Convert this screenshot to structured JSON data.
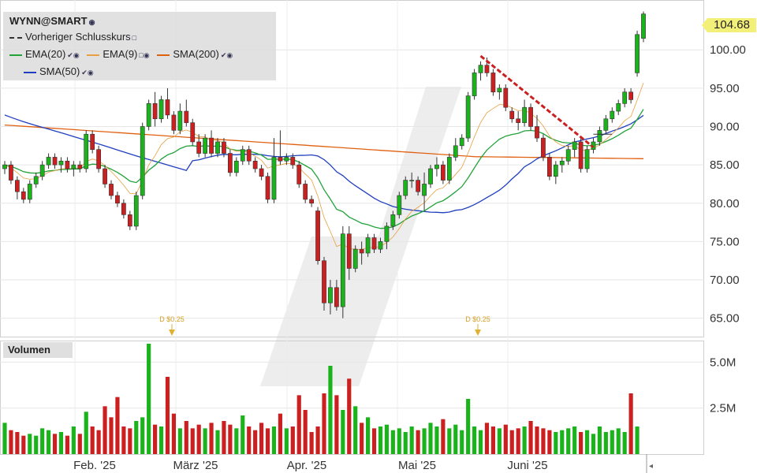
{
  "header": {
    "symbol": "WYNN@SMART",
    "legend": [
      {
        "label": "Vorheriger Schlusskurs",
        "color": "#333333",
        "style": "dashed"
      },
      {
        "label": "EMA(20)",
        "color": "#22a33a"
      },
      {
        "label": "EMA(9)",
        "color": "#e8a040"
      },
      {
        "label": "SMA(200)",
        "color": "#e06010"
      },
      {
        "label": "SMA(50)",
        "color": "#1f3fbf"
      }
    ]
  },
  "last_price": "104.68",
  "volume_label": "Volumen",
  "dividends": [
    "D $0.25",
    "D $0.25"
  ],
  "chart_data": {
    "type": "candlestick",
    "x_labels": [
      "Feb. '25",
      "März '25",
      "Apr. '25",
      "Mai '25",
      "Juni '25"
    ],
    "y_ticks": [
      "65.00",
      "70.00",
      "75.00",
      "80.00",
      "85.00",
      "90.00",
      "95.00",
      "100.00"
    ],
    "y_range": [
      62.5,
      106.5
    ],
    "volume_ticks": [
      "2.5M",
      "5.0M"
    ],
    "volume_range": [
      0,
      6.0
    ],
    "candles": [
      [
        84.5,
        85.5,
        83.8,
        85.0
      ],
      [
        85.0,
        85.5,
        82.5,
        83.0
      ],
      [
        83.0,
        83.5,
        80.5,
        81.5
      ],
      [
        81.5,
        82.0,
        80.0,
        80.5
      ],
      [
        80.5,
        83.0,
        80.0,
        82.5
      ],
      [
        82.5,
        84.0,
        82.0,
        83.5
      ],
      [
        83.5,
        85.5,
        83.0,
        85.0
      ],
      [
        85.0,
        86.5,
        84.5,
        86.0
      ],
      [
        86.0,
        86.5,
        84.5,
        85.0
      ],
      [
        85.0,
        86.0,
        84.0,
        85.5
      ],
      [
        85.5,
        86.0,
        84.0,
        84.5
      ],
      [
        84.5,
        85.5,
        83.5,
        85.0
      ],
      [
        85.0,
        85.5,
        84.0,
        84.5
      ],
      [
        84.5,
        89.5,
        84.0,
        89.0
      ],
      [
        89.0,
        89.5,
        86.5,
        87.0
      ],
      [
        87.0,
        87.5,
        84.0,
        84.5
      ],
      [
        84.5,
        85.0,
        82.0,
        82.5
      ],
      [
        82.5,
        83.0,
        80.5,
        81.0
      ],
      [
        81.0,
        81.5,
        79.5,
        80.0
      ],
      [
        80.0,
        80.5,
        78.0,
        78.5
      ],
      [
        78.5,
        79.0,
        76.5,
        77.0
      ],
      [
        77.0,
        81.5,
        76.5,
        81.0
      ],
      [
        81.0,
        90.5,
        80.5,
        90.0
      ],
      [
        90.0,
        93.5,
        89.5,
        93.0
      ],
      [
        93.0,
        94.5,
        90.0,
        91.0
      ],
      [
        91.0,
        94.0,
        90.5,
        93.5
      ],
      [
        93.5,
        95.0,
        91.0,
        91.5
      ],
      [
        91.5,
        92.0,
        89.0,
        89.5
      ],
      [
        89.5,
        93.0,
        89.0,
        92.0
      ],
      [
        92.0,
        93.5,
        90.0,
        90.5
      ],
      [
        90.5,
        91.0,
        87.5,
        88.0
      ],
      [
        88.0,
        89.0,
        86.0,
        86.5
      ],
      [
        86.5,
        89.0,
        86.0,
        88.5
      ],
      [
        88.5,
        89.5,
        86.0,
        86.5
      ],
      [
        86.5,
        88.5,
        86.0,
        88.0
      ],
      [
        88.0,
        88.5,
        86.0,
        86.5
      ],
      [
        86.5,
        87.0,
        83.5,
        84.0
      ],
      [
        84.0,
        86.0,
        83.5,
        85.5
      ],
      [
        85.5,
        87.5,
        85.0,
        87.0
      ],
      [
        87.0,
        87.5,
        85.0,
        85.5
      ],
      [
        85.5,
        86.0,
        84.0,
        84.5
      ],
      [
        84.5,
        85.0,
        83.0,
        83.5
      ],
      [
        83.5,
        84.0,
        80.0,
        80.5
      ],
      [
        80.5,
        88.5,
        80.0,
        86.0
      ],
      [
        86.0,
        89.5,
        85.0,
        85.5
      ],
      [
        85.5,
        86.5,
        85.0,
        86.0
      ],
      [
        86.0,
        86.5,
        84.5,
        85.0
      ],
      [
        85.0,
        85.5,
        82.0,
        82.5
      ],
      [
        82.5,
        83.0,
        80.0,
        80.5
      ],
      [
        80.5,
        81.0,
        79.5,
        80.0
      ],
      [
        79.0,
        79.5,
        72.0,
        72.5
      ],
      [
        72.5,
        73.0,
        66.0,
        67.0
      ],
      [
        67.0,
        70.0,
        65.5,
        69.0
      ],
      [
        69.0,
        70.0,
        66.0,
        66.5
      ],
      [
        66.5,
        77.0,
        65.0,
        76.0
      ],
      [
        76.0,
        77.0,
        70.0,
        71.5
      ],
      [
        71.5,
        74.5,
        71.0,
        74.0
      ],
      [
        74.0,
        75.0,
        72.0,
        73.5
      ],
      [
        73.5,
        76.0,
        73.0,
        75.5
      ],
      [
        75.5,
        76.0,
        73.5,
        74.0
      ],
      [
        74.0,
        75.5,
        73.5,
        75.0
      ],
      [
        75.0,
        77.5,
        74.0,
        77.0
      ],
      [
        77.0,
        79.0,
        76.5,
        78.5
      ],
      [
        78.5,
        81.5,
        78.0,
        81.0
      ],
      [
        81.0,
        83.5,
        80.5,
        83.0
      ],
      [
        83.0,
        84.0,
        82.0,
        83.0
      ],
      [
        83.0,
        83.5,
        81.0,
        81.5
      ],
      [
        81.0,
        84.0,
        79.0,
        82.5
      ],
      [
        82.5,
        85.0,
        82.0,
        84.5
      ],
      [
        84.5,
        86.0,
        83.5,
        85.0
      ],
      [
        85.0,
        85.5,
        82.5,
        83.0
      ],
      [
        83.0,
        86.5,
        82.5,
        86.0
      ],
      [
        86.0,
        88.5,
        85.5,
        87.5
      ],
      [
        87.5,
        89.0,
        87.0,
        88.5
      ],
      [
        88.5,
        94.5,
        88.0,
        94.0
      ],
      [
        94.0,
        97.5,
        93.5,
        97.0
      ],
      [
        97.0,
        98.5,
        96.0,
        98.0
      ],
      [
        98.0,
        99.0,
        96.5,
        97.0
      ],
      [
        97.0,
        97.5,
        94.0,
        94.5
      ],
      [
        94.5,
        95.5,
        93.5,
        95.0
      ],
      [
        95.0,
        95.5,
        92.0,
        92.5
      ],
      [
        92.0,
        92.5,
        90.5,
        91.0
      ],
      [
        91.0,
        92.0,
        89.5,
        90.5
      ],
      [
        90.5,
        93.5,
        90.0,
        92.5
      ],
      [
        92.5,
        93.0,
        89.5,
        90.0
      ],
      [
        90.0,
        91.5,
        88.0,
        88.5
      ],
      [
        88.5,
        89.0,
        85.5,
        86.0
      ],
      [
        86.0,
        86.5,
        83.0,
        83.5
      ],
      [
        83.5,
        85.5,
        82.5,
        85.0
      ],
      [
        85.0,
        86.0,
        84.0,
        85.5
      ],
      [
        85.5,
        87.5,
        85.0,
        87.0
      ],
      [
        87.0,
        88.5,
        86.0,
        88.0
      ],
      [
        88.0,
        88.5,
        84.0,
        84.5
      ],
      [
        84.5,
        87.5,
        84.0,
        87.0
      ],
      [
        87.0,
        88.5,
        86.5,
        88.0
      ],
      [
        88.0,
        90.0,
        87.5,
        89.5
      ],
      [
        89.5,
        91.5,
        89.0,
        91.0
      ],
      [
        91.0,
        92.5,
        90.5,
        92.0
      ],
      [
        92.0,
        93.5,
        91.5,
        93.0
      ],
      [
        93.0,
        95.0,
        92.5,
        94.5
      ],
      [
        94.5,
        95.0,
        93.0,
        93.5
      ],
      [
        97.0,
        102.5,
        96.5,
        102.0
      ],
      [
        101.5,
        105.0,
        101.0,
        104.68
      ]
    ],
    "volumes": [
      1.7,
      1.3,
      1.2,
      1.0,
      1.1,
      1.0,
      1.4,
      1.3,
      1.1,
      1.2,
      1.0,
      1.5,
      1.1,
      2.3,
      1.5,
      1.3,
      2.6,
      2.0,
      3.1,
      1.5,
      1.4,
      1.8,
      2.0,
      6.0,
      1.6,
      1.5,
      4.2,
      2.2,
      1.4,
      1.8,
      1.4,
      1.6,
      1.4,
      1.7,
      1.3,
      1.8,
      1.6,
      1.4,
      2.1,
      1.5,
      1.3,
      1.7,
      1.4,
      1.5,
      2.2,
      1.4,
      1.5,
      3.2,
      2.4,
      1.2,
      1.5,
      3.3,
      4.8,
      3.2,
      2.4,
      4.1,
      2.6,
      1.7,
      2.0,
      1.4,
      1.5,
      1.6,
      1.3,
      1.4,
      1.2,
      1.5,
      1.3,
      1.4,
      1.7,
      1.5,
      1.9,
      1.4,
      1.6,
      1.3,
      3.0,
      1.5,
      1.3,
      1.7,
      1.5,
      1.4,
      1.6,
      1.3,
      1.4,
      1.5,
      1.8,
      1.5,
      1.4,
      1.3,
      1.2,
      1.3,
      1.4,
      1.5,
      1.2,
      1.3,
      1.1,
      1.5,
      1.2,
      1.3,
      1.4,
      1.2,
      3.3,
      1.5
    ],
    "prev_close": 88.8
  }
}
